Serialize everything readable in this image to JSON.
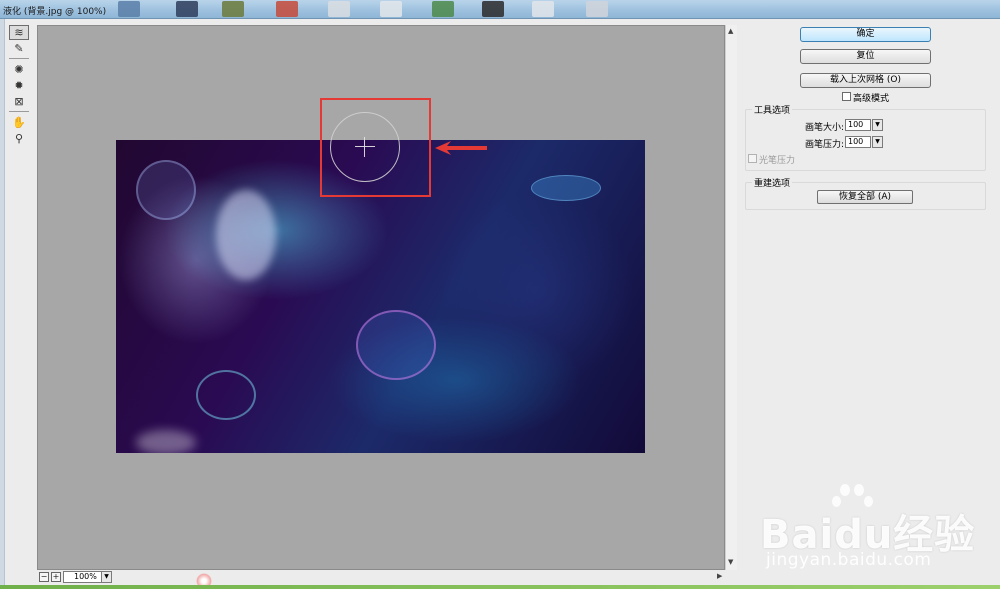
{
  "window": {
    "title": "液化 (背景.jpg @ 100%)"
  },
  "toolbar": {
    "tools": [
      {
        "name": "warp-tool-icon",
        "glyph": "≋",
        "active": true
      },
      {
        "name": "reconstruct-tool-icon",
        "glyph": "✎",
        "active": false
      },
      {
        "name": "pucker-tool-icon",
        "glyph": "✺",
        "active": false
      },
      {
        "name": "bloat-tool-icon",
        "glyph": "✹",
        "active": false
      },
      {
        "name": "push-left-tool-icon",
        "glyph": "⊠",
        "active": false
      },
      {
        "name": "hand-tool-icon",
        "glyph": "✋",
        "active": false
      },
      {
        "name": "zoom-tool-icon",
        "glyph": "⚲",
        "active": false
      }
    ]
  },
  "status": {
    "zoom_value": "100%",
    "zoom_out_glyph": "−",
    "zoom_in_glyph": "+",
    "dropdown_glyph": "▼"
  },
  "panel": {
    "ok_label": "确定",
    "reset_label": "复位",
    "load_mesh_label": "载入上次网格 (O)",
    "advanced_mode_label": "高级模式",
    "tool_options_title": "工具选项",
    "brush_size_label": "画笔大小:",
    "brush_size_value": "100",
    "brush_pressure_label": "画笔压力:",
    "brush_pressure_value": "100",
    "stylus_pressure_label": "光笔压力",
    "reconstruct_options_title": "重建选项",
    "restore_all_label": "恢复全部 (A)"
  },
  "watermark": {
    "brand": "Baidu经验",
    "url": "jingyan.baidu.com"
  },
  "colors": {
    "highlight": "#e53935",
    "canvas_bg": "#a7a7a7"
  }
}
